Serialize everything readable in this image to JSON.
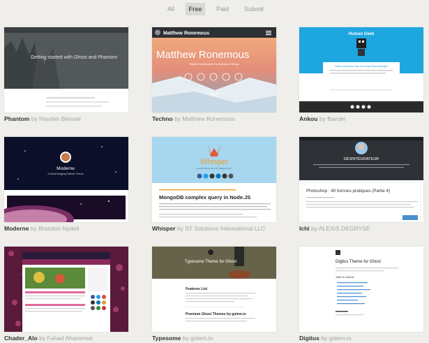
{
  "tabs": [
    "All",
    "Free",
    "Paid",
    "Submit"
  ],
  "active_tab": "Free",
  "by": "by",
  "themes": [
    {
      "name": "Phantom",
      "author": "Hayden Bleasel",
      "heading": "Getting started with Ghost and Phantom"
    },
    {
      "name": "Techno",
      "author": "Matthew Ronemous",
      "site_title": "Matthew Ronemous",
      "subtitle": "Mobile Development & Internet of things"
    },
    {
      "name": "Ankou",
      "author": "fbardel",
      "site_title": "Human Geek",
      "post_title": "Delete Temporary Files for Google Music Manager"
    },
    {
      "name": "Moderne",
      "author": "Brandon Nydell",
      "site_title": "Moderne",
      "subtitle": "A Ghost Blogging Platform Theme"
    },
    {
      "name": "Whisper",
      "author": "ST Solutions International LLC",
      "site_title": "Whisper",
      "subtitle": "A Ghost theme from ST Solutions LLC",
      "post_title": "MongoDB complex query in Node.JS"
    },
    {
      "name": "Ichi",
      "author": "ALEXIS DEGRYSE",
      "site_title": "DÉSINTÉGRATEUR",
      "post_title": "Photoshop : 40 bonnes pratiques (Partie 4)"
    },
    {
      "name": "Chader_Alo",
      "author": "Fahad Ahammed"
    },
    {
      "name": "Typesome",
      "author": "golem.io",
      "heading": "Typesome Theme for Ghost",
      "post1": "Features List",
      "post2": "Premium Ghost Themes by golem.io"
    },
    {
      "name": "Digitus",
      "author": "golem.io",
      "site_title": "Digitus Theme for Ghost",
      "toc": "Table of contents"
    }
  ],
  "colors": {
    "background": "#efeeea",
    "whisper_accent": "#f0a030",
    "ankou_accent": "#20a8e0",
    "techno_sky": "#ee9a6a"
  }
}
